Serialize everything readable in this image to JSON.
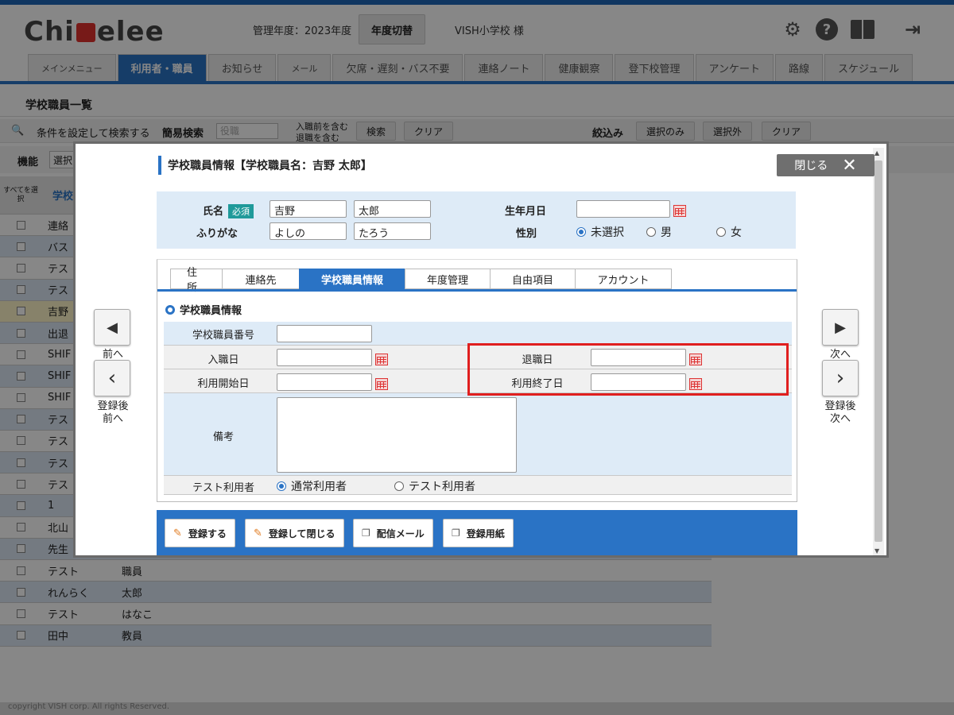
{
  "header": {
    "logo": "Chi▲elee",
    "year_label": "管理年度：2023年度",
    "year_switch": "年度切替",
    "school": "VISH小学校 様",
    "icons": [
      "gear-icon",
      "help-icon",
      "book-icon",
      "logout-icon"
    ]
  },
  "nav": {
    "tabs": [
      "メインメニュー",
      "利用者・職員",
      "お知らせ",
      "メール",
      "欠席・遅刻・バス不要",
      "連絡ノート",
      "健康観察",
      "登下校管理",
      "アンケート",
      "路線",
      "スケジュール"
    ]
  },
  "page": {
    "title": "学校職員一覧",
    "search_toggle": "条件を設定して検索する",
    "simple_search": "簡易検索",
    "select_placeholder": "役職",
    "chk1": "入職前を含む",
    "chk2": "退職を含む",
    "search_btn": "検索",
    "clear_btn": "クリア",
    "narrow": "絞込み",
    "sel_only": "選択のみ",
    "sel_out": "選択外",
    "clear2": "クリア",
    "func": "機能",
    "func_select": "選択",
    "select_all": "すべてを選択",
    "col_school": "学校"
  },
  "table": {
    "rows": [
      {
        "c1": "連絡",
        "c2": ""
      },
      {
        "c1": "バス",
        "c2": ""
      },
      {
        "c1": "テス",
        "c2": ""
      },
      {
        "c1": "テス",
        "c2": ""
      },
      {
        "c1": "吉野",
        "c2": ""
      },
      {
        "c1": "出退",
        "c2": ""
      },
      {
        "c1": "SHIF",
        "c2": ""
      },
      {
        "c1": "SHIF",
        "c2": ""
      },
      {
        "c1": "SHIF",
        "c2": ""
      },
      {
        "c1": "テス",
        "c2": ""
      },
      {
        "c1": "テス",
        "c2": ""
      },
      {
        "c1": "テス",
        "c2": ""
      },
      {
        "c1": "テス",
        "c2": ""
      },
      {
        "c1": "1",
        "c2": ""
      },
      {
        "c1": "北山",
        "c2": ""
      },
      {
        "c1": "先生",
        "c2": ""
      },
      {
        "c1": "テスト",
        "c2": "職員"
      },
      {
        "c1": "れんらく",
        "c2": "太郎"
      },
      {
        "c1": "テスト",
        "c2": "はなこ"
      },
      {
        "c1": "田中",
        "c2": "教員"
      }
    ]
  },
  "footer": "copyright VISH corp. All rights Reserved.",
  "modal": {
    "title": "学校職員情報【学校職員名：吉野 太郎】",
    "close": "閉じる",
    "prev": "前へ",
    "next": "次へ",
    "save_prev": "登録後\n前へ",
    "save_next": "登録後\n次へ",
    "name_label": "氏名",
    "required": "必須",
    "last_name": "吉野",
    "first_name": "太郎",
    "kana_label": "ふりがな",
    "last_kana": "よしの",
    "first_kana": "たろう",
    "birth_label": "生年月日",
    "birth_value": "",
    "gender_label": "性別",
    "gender_options": [
      "未選択",
      "男",
      "女"
    ],
    "gender_selected": "未選択",
    "tabs": [
      "住所",
      "連絡先",
      "学校職員情報",
      "年度管理",
      "自由項目",
      "アカウント"
    ],
    "active_tab": "学校職員情報",
    "section": "学校職員情報",
    "staff_no_label": "学校職員番号",
    "hire_label": "入職日",
    "retire_label": "退職日",
    "start_label": "利用開始日",
    "end_label": "利用終了日",
    "note_label": "備考",
    "test_label": "テスト利用者",
    "test_options": [
      "通常利用者",
      "テスト利用者"
    ],
    "test_selected": "通常利用者",
    "actions": [
      "登録する",
      "登録して閉じる",
      "配信メール",
      "登録用紙"
    ]
  }
}
